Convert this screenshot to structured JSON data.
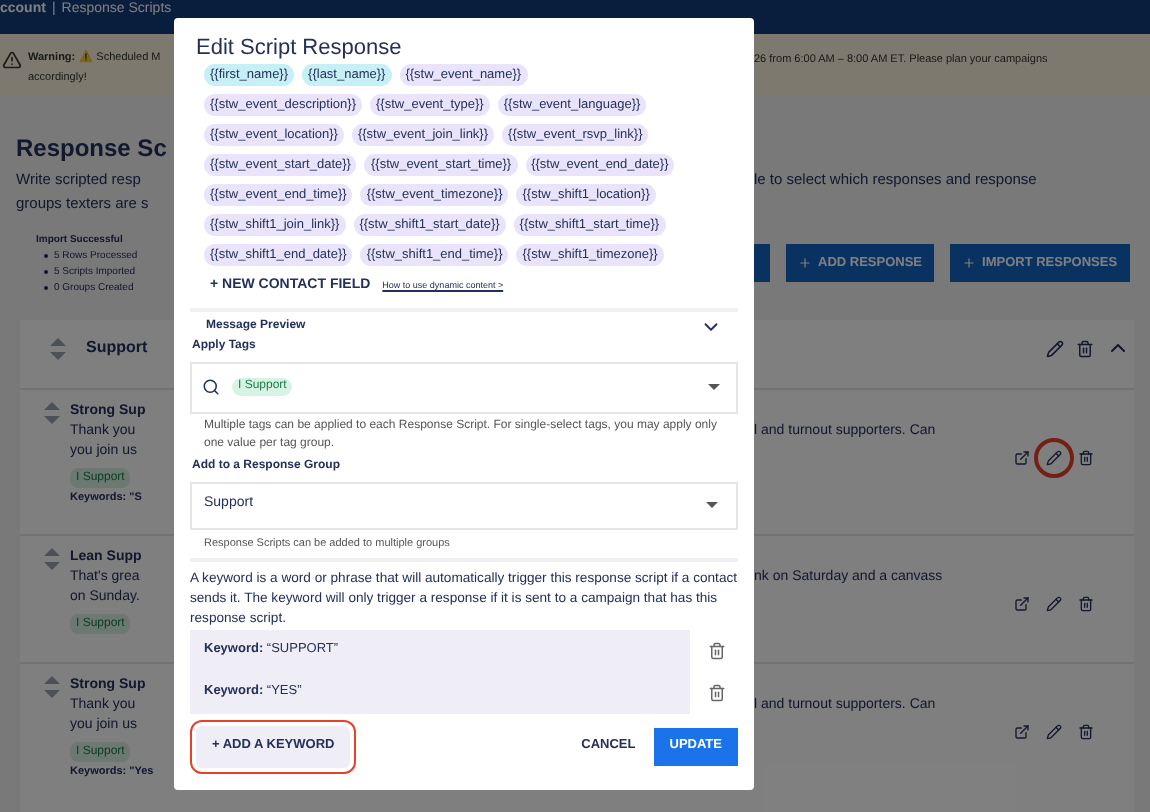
{
  "header": {
    "account": "ccount",
    "separator": "|",
    "page": "Response Scripts"
  },
  "warning": {
    "label": "Warning:",
    "text_left": "⚠️ Scheduled M",
    "text_right": "26 from 6:00 AM – 8:00 AM ET. Please plan your campaigns",
    "text_line2": "accordingly!"
  },
  "page": {
    "title": "Response Sc",
    "description_left": [
      "Write scripted resp",
      "groups texters are s"
    ],
    "description_right": "le to select which responses and response"
  },
  "import_summary": {
    "title": "Import Successful",
    "items": [
      "5 Rows Processed",
      "5 Scripts Imported",
      "0 Groups Created"
    ]
  },
  "toolbar": {
    "buttons": [
      "ADD RESPONSE",
      "IMPORT RESPONSES"
    ]
  },
  "group": {
    "name": "Support",
    "expanded": true,
    "scripts": [
      {
        "title": "Strong Sup",
        "lines_left": [
          "Thank you",
          "you join us"
        ],
        "text_right": "l and turnout supporters. Can",
        "tag": "I Support",
        "keywords": "Keywords: \"S",
        "edit_highlighted": true
      },
      {
        "title": "Lean Supp",
        "lines_left": [
          "That's grea",
          "on Sunday."
        ],
        "text_right": "nk on Saturday and a canvass",
        "tag": "I Support",
        "edit_highlighted": false
      },
      {
        "title": "Strong Sup",
        "lines_left": [
          "Thank you",
          "you join us"
        ],
        "text_right": "l and turnout supporters. Can",
        "tag": "I Support",
        "keywords": "Keywords: \"Yes",
        "edit_highlighted": false
      }
    ]
  },
  "modal": {
    "title": "Edit Script Response",
    "chip_rows": [
      [
        {
          "text": "{{first_name}}",
          "kind": "contact"
        },
        {
          "text": "{{last_name}}",
          "kind": "contact"
        },
        {
          "text": "{{stw_event_name}}",
          "kind": "event"
        }
      ],
      [
        {
          "text": "{{stw_event_description}}",
          "kind": "event"
        },
        {
          "text": "{{stw_event_type}}",
          "kind": "event"
        },
        {
          "text": "{{stw_event_language}}",
          "kind": "event"
        }
      ],
      [
        {
          "text": "{{stw_event_location}}",
          "kind": "event"
        },
        {
          "text": "{{stw_event_join_link}}",
          "kind": "event"
        },
        {
          "text": "{{stw_event_rsvp_link}}",
          "kind": "event"
        }
      ],
      [
        {
          "text": "{{stw_event_start_date}}",
          "kind": "event"
        },
        {
          "text": "{{stw_event_start_time}}",
          "kind": "event"
        },
        {
          "text": "{{stw_event_end_date}}",
          "kind": "event"
        }
      ],
      [
        {
          "text": "{{stw_event_end_time}}",
          "kind": "event"
        },
        {
          "text": "{{stw_event_timezone}}",
          "kind": "event"
        },
        {
          "text": "{{stw_shift1_location}}",
          "kind": "event"
        }
      ],
      [
        {
          "text": "{{stw_shift1_join_link}}",
          "kind": "event"
        },
        {
          "text": "{{stw_shift1_start_date}}",
          "kind": "event"
        },
        {
          "text": "{{stw_shift1_start_time}}",
          "kind": "event"
        }
      ],
      [
        {
          "text": "{{stw_shift1_end_date}}",
          "kind": "event"
        },
        {
          "text": "{{stw_shift1_end_time}}",
          "kind": "event"
        },
        {
          "text": "{{stw_shift1_timezone}}",
          "kind": "event"
        }
      ]
    ],
    "new_field_button": "+ NEW CONTACT FIELD",
    "help_link": "How to use dynamic content >",
    "preview": {
      "label": "Message Preview",
      "expanded": false
    },
    "tags": {
      "label": "Apply Tags",
      "selected": [
        "I Support"
      ],
      "help": "Multiple tags can be applied to each Response Script. For single-select tags, you may apply only one value per tag group."
    },
    "response_group": {
      "label": "Add to a Response Group",
      "value": "Support",
      "help": "Response Scripts can be added to multiple groups"
    },
    "keyword_help": "A keyword is a word or phrase that will automatically trigger this response script if a contact sends it. The keyword will only trigger a response if it is sent to a campaign that has this response script.",
    "keywords": [
      "**Keyword:** “SUPPORT”",
      "**Keyword:** “YES”"
    ],
    "add_keyword": {
      "label": "+ ADD A KEYWORD",
      "highlighted": true
    },
    "cancel": "CANCEL",
    "update": "UPDATE"
  }
}
